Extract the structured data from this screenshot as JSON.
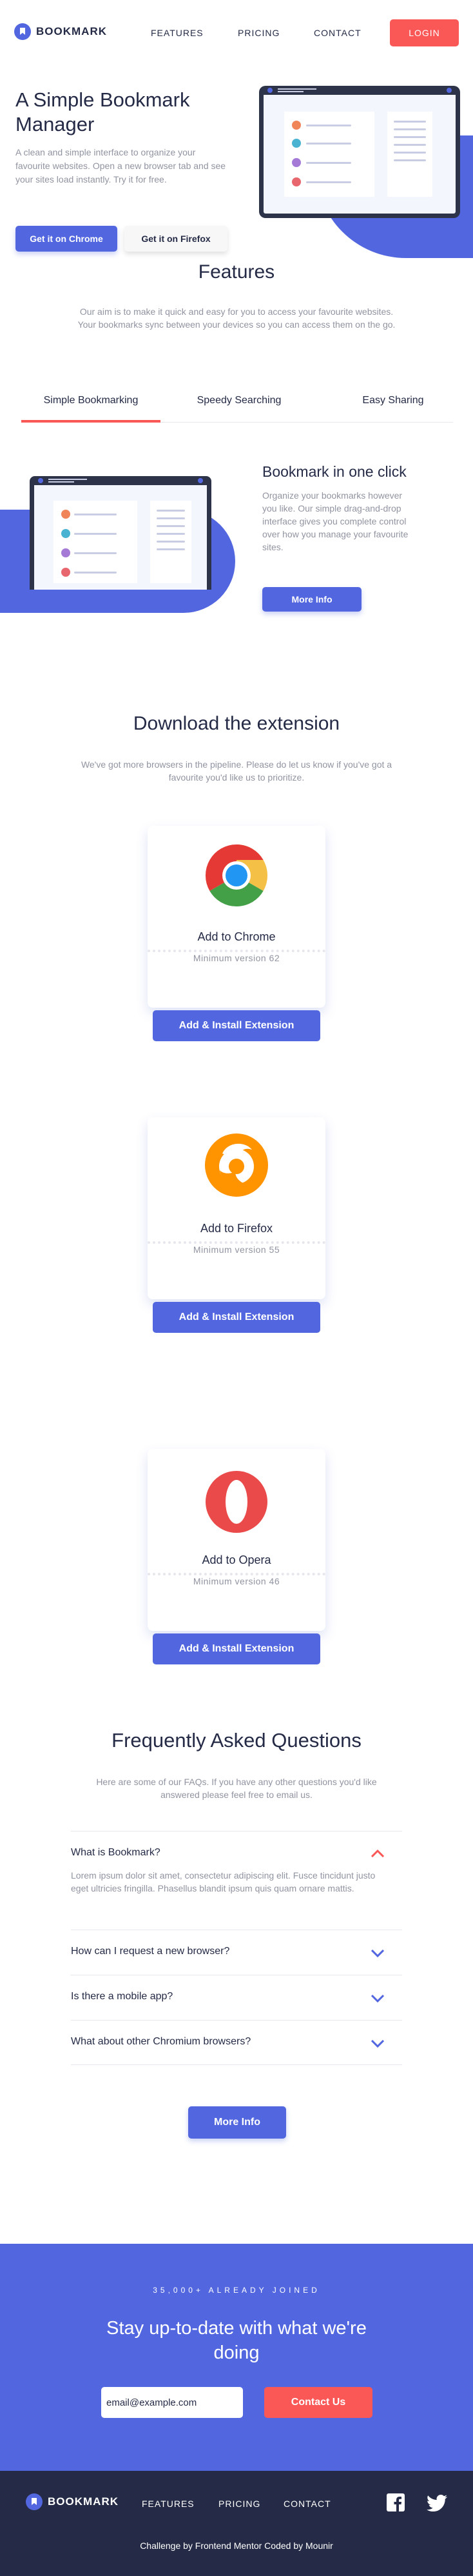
{
  "header": {
    "logo_text": "BOOKMARK",
    "nav": [
      "FEATURES",
      "PRICING",
      "CONTACT"
    ],
    "login_label": "LOGIN"
  },
  "hero": {
    "title": "A Simple Bookmark Manager",
    "text": "A clean and simple interface to organize your favourite websites. Open a new browser tab and see your sites load instantly. Try it for free.",
    "chrome_button": "Get it on Chrome",
    "firefox_button": "Get it on Firefox"
  },
  "features": {
    "title": "Features",
    "text": "Our aim is to make it quick and easy for you to access your favourite websites. Your bookmarks sync between your devices so you can access them on the go.",
    "tabs": [
      "Simple Bookmarking",
      "Speedy Searching",
      "Easy Sharing"
    ],
    "active_tab": "Simple Bookmarking",
    "panel_title": "Bookmark in one click",
    "panel_text": "Organize your bookmarks however you like. Our simple drag-and-drop interface gives you complete control over how you manage your favourite sites.",
    "panel_button": "More Info"
  },
  "download": {
    "title": "Download the extension",
    "text": "We've got more browsers in the pipeline. Please do let us know if you've got a favourite you'd like us to prioritize.",
    "cards": [
      {
        "name": "Add to Chrome",
        "version": "Minimum version 62",
        "button": "Add & Install Extension",
        "icon": "chrome-icon"
      },
      {
        "name": "Add to Firefox",
        "version": "Minimum version 55",
        "button": "Add & Install Extension",
        "icon": "firefox-icon"
      },
      {
        "name": "Add to Opera",
        "version": "Minimum version 46",
        "button": "Add & Install Extension",
        "icon": "opera-icon"
      }
    ]
  },
  "faq": {
    "title": "Frequently Asked Questions",
    "text": "Here are some of our FAQs. If you have any other questions you'd like answered please feel free to email us.",
    "items": [
      {
        "question": "What is Bookmark?",
        "answer": "Lorem ipsum dolor sit amet, consectetur adipiscing elit. Fusce tincidunt justo eget ultricies fringilla. Phasellus blandit ipsum quis quam ornare mattis.",
        "open": true
      },
      {
        "question": "How can I request a new browser?",
        "open": false
      },
      {
        "question": "Is there a mobile app?",
        "open": false
      },
      {
        "question": "What about other Chromium browsers?",
        "open": false
      }
    ],
    "button": "More Info"
  },
  "newsletter": {
    "eyebrow": "35,000+ ALREADY JOINED",
    "title": "Stay up-to-date with what we're doing",
    "email_value": "email@example.com",
    "button": "Contact Us"
  },
  "footer": {
    "logo_text": "BOOKMARK",
    "nav": [
      "FEATURES",
      "PRICING",
      "CONTACT"
    ],
    "attribution": "Challenge by Frontend Mentor Coded by Mounir",
    "social_icons": [
      "facebook-icon",
      "twitter-icon"
    ]
  },
  "colors": {
    "primary": "#5267df",
    "accent": "#fa5757",
    "dark": "#252b46",
    "muted": "#9194a1"
  }
}
